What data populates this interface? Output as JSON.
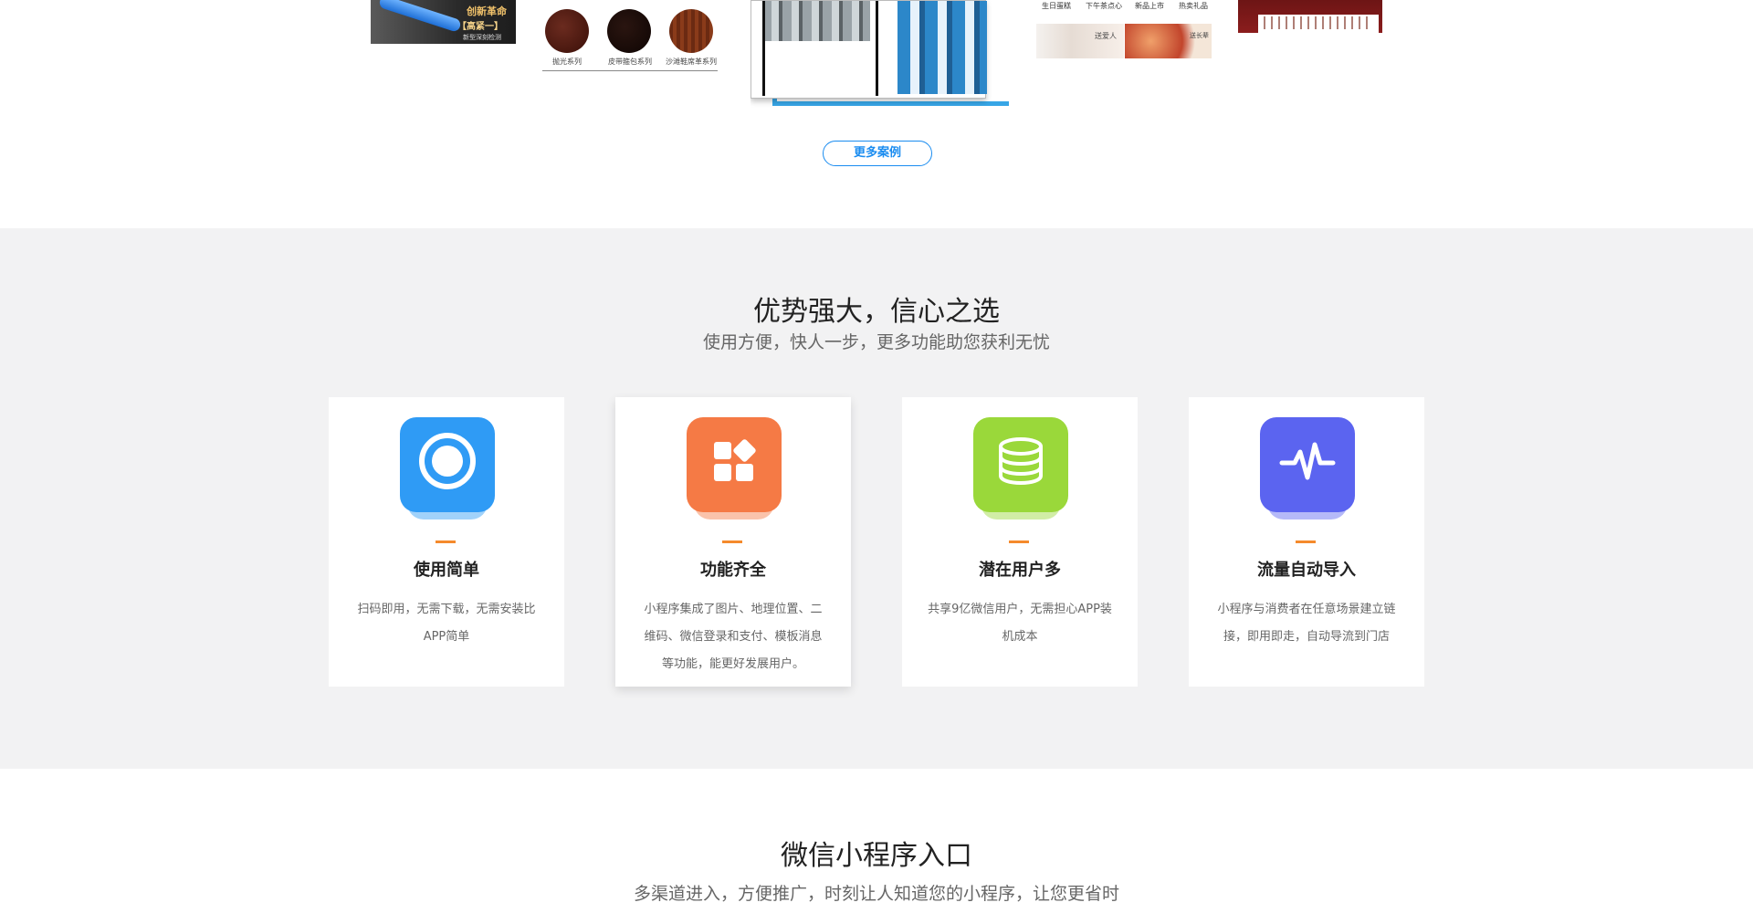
{
  "cases": {
    "case1": {
      "title": "创新革命",
      "subtitle": "【高紧一】",
      "caption": "新型深刻检测"
    },
    "case2": {
      "labels": [
        "抛光系列",
        "皮带箍包系列",
        "沙滩鞋席革系列"
      ]
    },
    "case4": {
      "nav": [
        "生日蛋糕",
        "下午茶点心",
        "新品上市",
        "热卖礼品"
      ],
      "tag1": "送爱人",
      "tag2": "送长辈"
    },
    "more_button": "更多案例"
  },
  "advantages": {
    "title": "优势强大，信心之选",
    "subtitle": "使用方便，快人一步，更多功能助您获利无忧",
    "cards": [
      {
        "title": "使用简单",
        "desc": "扫码即用，无需下载，无需安装比APP简单",
        "icon": "scan-circle-icon",
        "color": "#2f9bf5"
      },
      {
        "title": "功能齐全",
        "desc": "小程序集成了图片、地理位置、二维码、微信登录和支付、模板消息等功能，能更好发展用户。",
        "icon": "grid-apps-icon",
        "color": "#f57a45"
      },
      {
        "title": "潜在用户多",
        "desc": "共享9亿微信用户，无需担心APP装机成本",
        "icon": "database-icon",
        "color": "#9ad83a"
      },
      {
        "title": "流量自动导入",
        "desc": "小程序与消费者在任意场景建立链接，即用即走，自动导流到门店",
        "icon": "pulse-icon",
        "color": "#5b64f0"
      }
    ]
  },
  "entry": {
    "title": "微信小程序入口",
    "subtitle": "多渠道进入，方便推广，时刻让人知道您的小程序，让您更省时"
  },
  "colors": {
    "accent": "#1a8cf0",
    "dash": "#f58a2c",
    "section_bg": "#f2f2f3"
  }
}
